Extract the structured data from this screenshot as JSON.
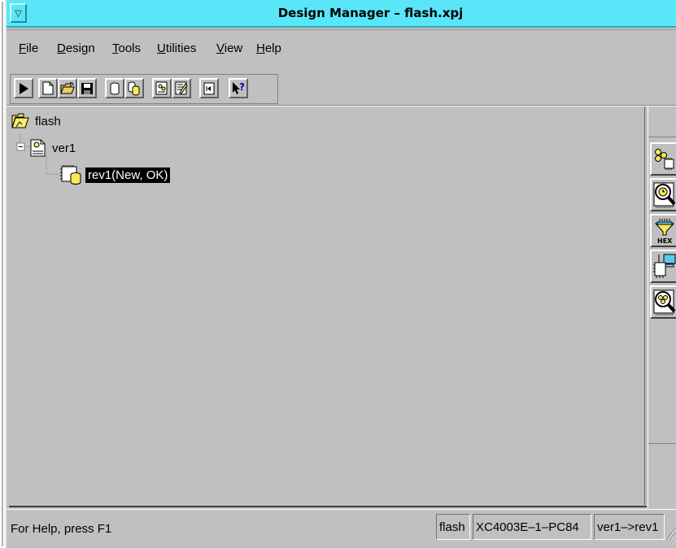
{
  "window": {
    "title": "Design Manager – flash.xpj",
    "system_menu_glyph": "▽",
    "titlebar_color": "#58e6f8",
    "face_color": "#c0c0c0"
  },
  "menu": [
    {
      "label": "File",
      "mnemonic_index": 0
    },
    {
      "label": "Design",
      "mnemonic_index": 0
    },
    {
      "label": "Tools",
      "mnemonic_index": 0
    },
    {
      "label": "Utilities",
      "mnemonic_index": 0
    },
    {
      "label": "View",
      "mnemonic_index": 0
    },
    {
      "label": "Help",
      "mnemonic_index": 0
    }
  ],
  "toolbar": {
    "buttons": [
      {
        "name": "run-button",
        "icon": "play-icon"
      },
      {
        "name": "new-button",
        "icon": "new-document-icon"
      },
      {
        "name": "open-button",
        "icon": "open-folder-icon"
      },
      {
        "name": "save-button",
        "icon": "floppy-disk-icon"
      },
      {
        "name": "new-version-button",
        "icon": "cylinder-icon"
      },
      {
        "name": "new-revision-button",
        "icon": "cylinders-icon"
      },
      {
        "name": "report-browser-button",
        "icon": "report-icon"
      },
      {
        "name": "edit-report-button",
        "icon": "edit-report-icon"
      },
      {
        "name": "back-button",
        "icon": "back-arrow-icon"
      },
      {
        "name": "context-help-button",
        "icon": "pointer-question-icon"
      }
    ]
  },
  "tree": {
    "project": {
      "label": "flash",
      "icon": "project-folder-icon"
    },
    "version": {
      "label": "ver1",
      "icon": "version-document-icon"
    },
    "revision": {
      "label": "rev1(New, OK)",
      "icon": "revision-chip-icon",
      "selected": true
    },
    "selection_color": "#000000"
  },
  "flow_tools": [
    {
      "name": "flow-engine-button",
      "icon": "flow-chip-icon"
    },
    {
      "name": "timing-analyzer-button",
      "icon": "timing-magnifier-icon"
    },
    {
      "name": "prom-formatter-button",
      "icon": "hex-funnel-icon",
      "caption": "HEX"
    },
    {
      "name": "hardware-debugger-button",
      "icon": "debugger-computer-icon"
    },
    {
      "name": "epic-design-editor-button",
      "icon": "chip-magnifier-icon"
    }
  ],
  "status": {
    "help": "For Help, press F1",
    "project": "flash",
    "device": "XC4003E–1–PC84",
    "revision": "ver1–>rev1"
  }
}
